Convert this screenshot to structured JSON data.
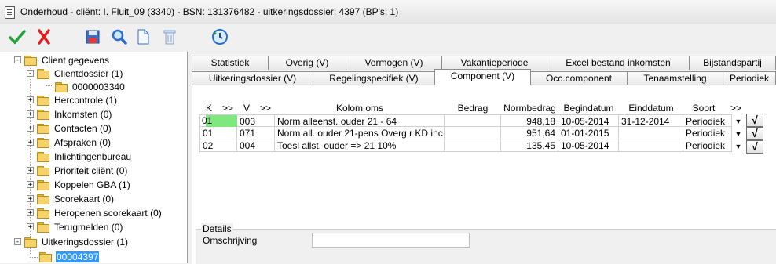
{
  "window": {
    "title": "Onderhoud - cliënt: I. Fluit_09 (3340) - BSN: 131376482 - uitkeringsdossier: 4397 (BP's: 1)"
  },
  "toolbar": {
    "buttons": [
      {
        "name": "ok",
        "icon": "checkmark-icon"
      },
      {
        "name": "cancel",
        "icon": "x-icon"
      },
      {
        "name": "save",
        "icon": "save-icon"
      },
      {
        "name": "search",
        "icon": "magnifier-icon"
      },
      {
        "name": "new-document",
        "icon": "document-icon"
      },
      {
        "name": "delete",
        "icon": "trash-icon"
      },
      {
        "name": "refresh",
        "icon": "refresh-clock-icon"
      }
    ]
  },
  "tree": {
    "items": [
      {
        "label": "Client gegevens",
        "expander": "-"
      },
      {
        "label": "Clientdossier (1)",
        "expander": "-"
      },
      {
        "label": "0000003340"
      },
      {
        "label": "Hercontrole (1)",
        "expander": "+"
      },
      {
        "label": "Inkomsten (0)",
        "expander": "+"
      },
      {
        "label": "Contacten (0)",
        "expander": "+"
      },
      {
        "label": "Afspraken (0)",
        "expander": "+"
      },
      {
        "label": "Inlichtingenbureau"
      },
      {
        "label": "Prioriteit cliënt (0)",
        "expander": "+"
      },
      {
        "label": "Koppelen GBA (1)",
        "expander": "+"
      },
      {
        "label": "Scorekaart (0)",
        "expander": "+"
      },
      {
        "label": "Heropenen scorekaart (0)",
        "expander": "+"
      },
      {
        "label": "Terugmelden (0)",
        "expander": "+"
      },
      {
        "label": "Uitkeringsdossier (1)",
        "expander": "-"
      },
      {
        "label": "00004397"
      }
    ]
  },
  "tabs": {
    "row1": [
      "Statistiek",
      "Overig (V)",
      "Vermogen (V)",
      "Vakantieperiode",
      "Excel bestand inkomsten",
      "Bijstandspartij"
    ],
    "row2": [
      "Uitkeringsdossier (V)",
      "Regelingspecifiek (V)",
      "Component (V)",
      "Occ.component",
      "Tenaamstelling",
      "Periodiek"
    ],
    "active": "Component (V)"
  },
  "grid": {
    "headers": [
      "K",
      ">>",
      "V",
      ">>",
      "Kolom oms",
      "Bedrag",
      "Normbedrag",
      "Begindatum",
      "Einddatum",
      "Soort",
      ">>"
    ],
    "rows": [
      {
        "k": "01",
        "v": "003",
        "oms": "Norm alleenst. ouder 21 - 64",
        "bedrag": "",
        "norm": "948,18",
        "begin": "10-05-2014",
        "eind": "31-12-2014",
        "soort": "Periodiek"
      },
      {
        "k": "01",
        "v": "071",
        "oms": "Norm all. ouder 21-pens Overg.r  KD inc",
        "bedrag": "",
        "norm": "951,64",
        "begin": "01-01-2015",
        "eind": "",
        "soort": "Periodiek"
      },
      {
        "k": "02",
        "v": "004",
        "oms": "Toesl allst. ouder => 21 10%",
        "bedrag": "",
        "norm": "135,45",
        "begin": "10-05-2014",
        "eind": "",
        "soort": "Periodiek"
      }
    ],
    "check_glyph": "√",
    "dropdown_glyph": "▼"
  },
  "details": {
    "legend": "Details",
    "omschrijving_label": "Omschrijving",
    "omschrijving_value": ""
  },
  "colors": {
    "selection": "#3399ff",
    "highlight_cell": "#7ee87e",
    "folder": "#f5d36a"
  }
}
